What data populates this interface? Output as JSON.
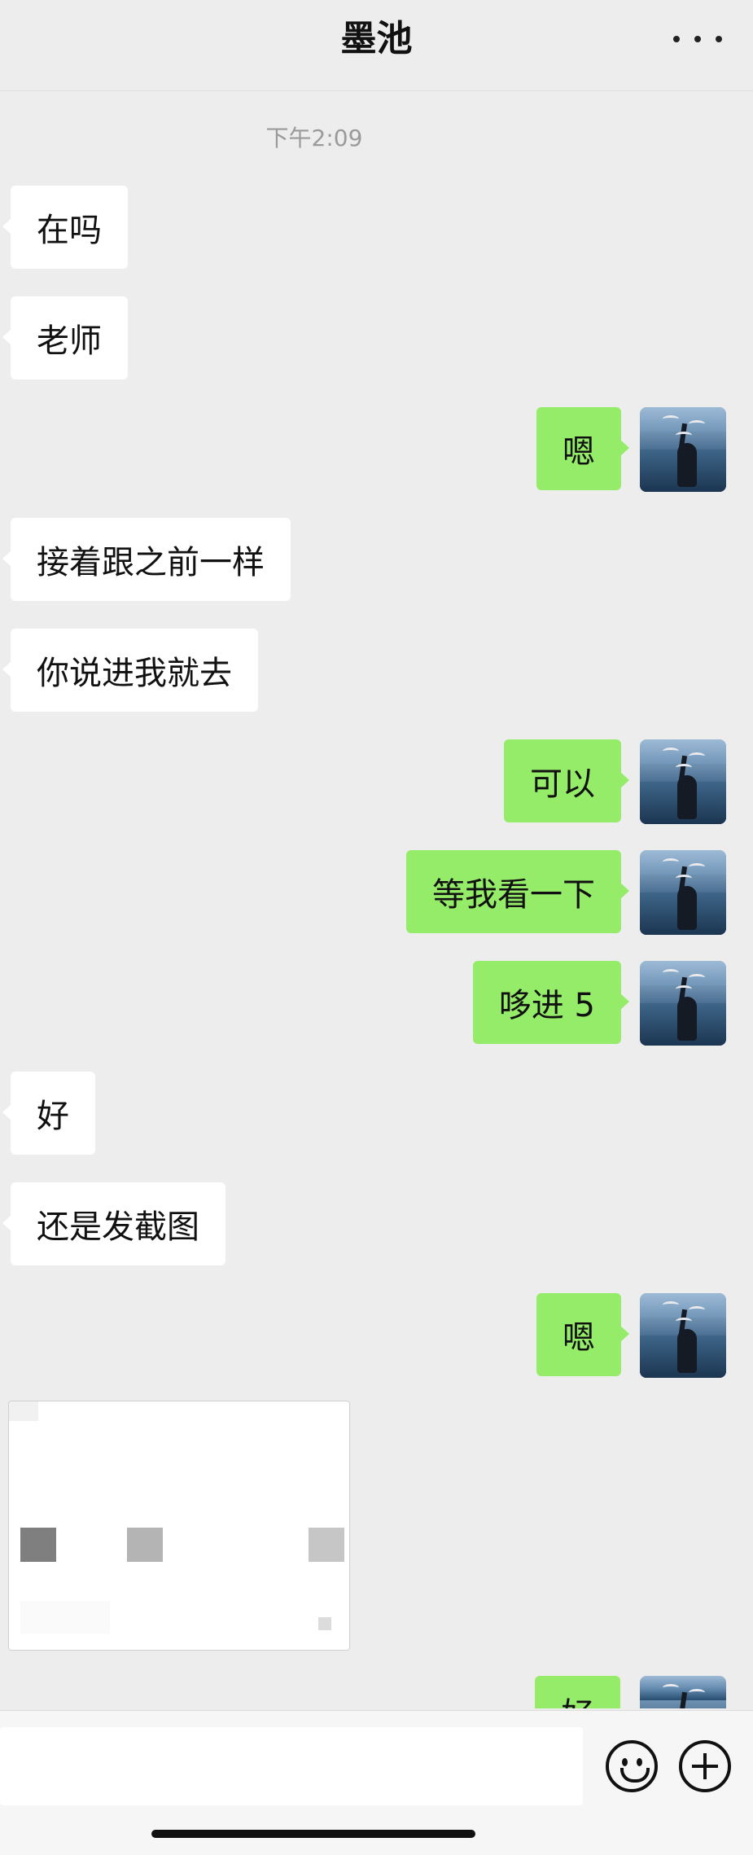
{
  "header": {
    "title": "墨池",
    "more_icon": "more-dots-icon"
  },
  "timestamp": "下午2:09",
  "messages": [
    {
      "side": "in",
      "text": "在吗"
    },
    {
      "side": "in",
      "text": "老师"
    },
    {
      "side": "out",
      "text": "嗯"
    },
    {
      "side": "in",
      "text": "接着跟之前一样"
    },
    {
      "side": "in",
      "text": "你说进我就去"
    },
    {
      "side": "out",
      "text": "可以"
    },
    {
      "side": "out",
      "text": "等我看一下"
    },
    {
      "side": "out",
      "text": "哆进 5"
    },
    {
      "side": "in",
      "text": "好"
    },
    {
      "side": "in",
      "text": "还是发截图"
    },
    {
      "side": "out",
      "text": "嗯"
    },
    {
      "side": "out",
      "text": "好"
    }
  ],
  "colors": {
    "background": "#ededed",
    "outgoing_bubble": "#95ec69",
    "incoming_bubble": "#ffffff"
  },
  "footer": {
    "emoji_icon": "emoji-face-icon",
    "plus_icon": "plus-circle-icon"
  }
}
